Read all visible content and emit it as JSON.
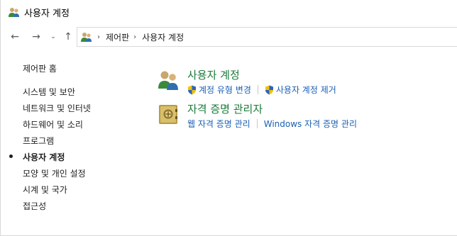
{
  "window": {
    "title": "사용자 계정"
  },
  "navigation": {
    "back": "←",
    "forward": "→",
    "recent": "⌄",
    "up": "↑",
    "breadcrumb": [
      "제어판",
      "사용자 계정"
    ],
    "separator": "›"
  },
  "sidebar": {
    "home": "제어판 홈",
    "items": [
      {
        "label": "시스템 및 보안",
        "active": false
      },
      {
        "label": "네트워크 및 인터넷",
        "active": false
      },
      {
        "label": "하드웨어 및 소리",
        "active": false
      },
      {
        "label": "프로그램",
        "active": false
      },
      {
        "label": "사용자 계정",
        "active": true
      },
      {
        "label": "모양 및 개인 설정",
        "active": false
      },
      {
        "label": "시계 및 국가",
        "active": false
      },
      {
        "label": "접근성",
        "active": false
      }
    ]
  },
  "categories": [
    {
      "title": "사용자 계정",
      "icon": "users-icon",
      "links": [
        {
          "label": "계정 유형 변경",
          "shield": true
        },
        {
          "label": "사용자 계정 제거",
          "shield": true
        }
      ]
    },
    {
      "title": "자격 증명 관리자",
      "icon": "credential-vault-icon",
      "links": [
        {
          "label": "웹 자격 증명 관리",
          "shield": false
        },
        {
          "label": "Windows 자격 증명 관리",
          "shield": false
        }
      ]
    }
  ],
  "colors": {
    "category_title": "#1a7a3a",
    "link": "#1a5fb4",
    "text": "#1e1e1e"
  }
}
